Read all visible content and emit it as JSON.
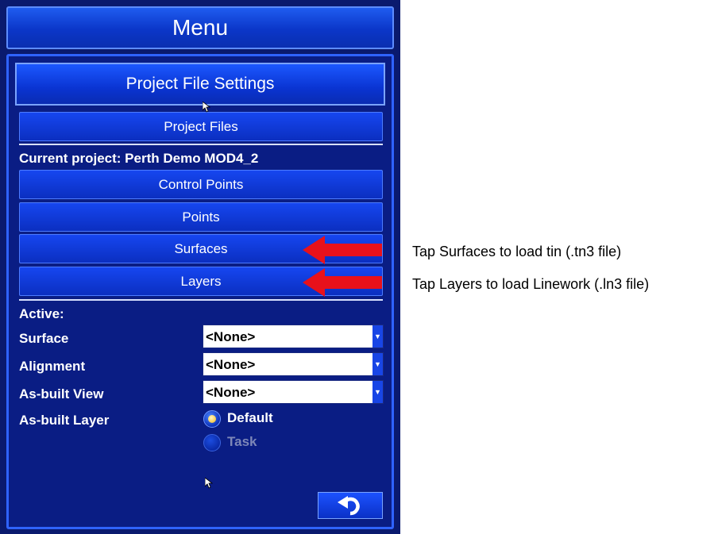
{
  "window": {
    "title": "Menu"
  },
  "project_file_settings": {
    "label": "Project File Settings"
  },
  "project_files": {
    "label": "Project Files"
  },
  "current_project": {
    "text": "Current project: Perth Demo MOD4_2"
  },
  "buttons": {
    "control_points": "Control Points",
    "points": "Points",
    "surfaces": "Surfaces",
    "layers": "Layers"
  },
  "active": {
    "heading": "Active:",
    "surface": {
      "label": "Surface",
      "value": "<None>"
    },
    "alignment": {
      "label": "Alignment",
      "value": "<None>"
    },
    "asbuilt_view": {
      "label": "As-built View",
      "value": "<None>"
    },
    "asbuilt_layer": {
      "label": "As-built Layer",
      "options": [
        {
          "label": "Default",
          "selected": true
        },
        {
          "label": "Task",
          "selected": false,
          "enabled": false
        }
      ]
    }
  },
  "annotations": {
    "surfaces_note": "Tap Surfaces to load tin (.tn3 file)",
    "layers_note": "Tap Layers to load Linework (.ln3 file)"
  },
  "icons": {
    "dropdown_arrow": "chevron-down-icon",
    "back": "undo-arrow-icon",
    "pointer": "mouse-pointer-icon",
    "callout": "red-arrow-icon"
  },
  "colors": {
    "accent": "#0b36c8",
    "panel": "#0a1d84",
    "callout_red": "#e8111b",
    "radio_selected": "#f2b61c"
  }
}
